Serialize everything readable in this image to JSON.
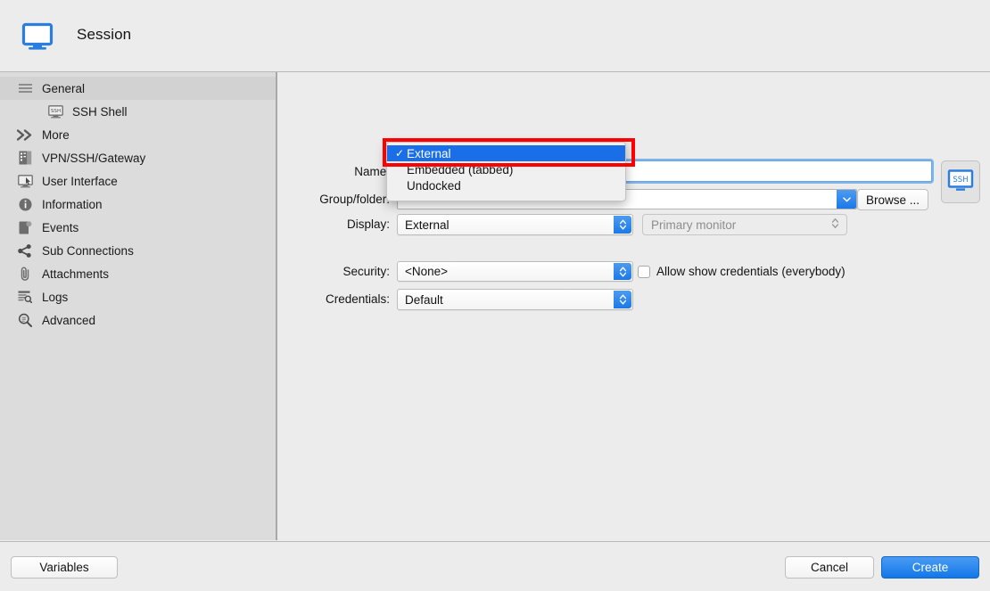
{
  "window": {
    "title": "Session",
    "icon": "monitor-icon"
  },
  "sidebar": {
    "items": [
      {
        "label": "General",
        "icon": "list-lines-icon",
        "selected": true,
        "sub": false
      },
      {
        "label": "SSH Shell",
        "icon": "ssh-terminal-icon",
        "selected": false,
        "sub": true
      },
      {
        "label": "More",
        "icon": "chevrons-right-icon",
        "selected": false,
        "sub": false
      },
      {
        "label": "VPN/SSH/Gateway",
        "icon": "server-icon",
        "selected": false,
        "sub": false
      },
      {
        "label": "User Interface",
        "icon": "monitor-cursor-icon",
        "selected": false,
        "sub": false
      },
      {
        "label": "Information",
        "icon": "info-circle-icon",
        "selected": false,
        "sub": false
      },
      {
        "label": "Events",
        "icon": "events-icon",
        "selected": false,
        "sub": false
      },
      {
        "label": "Sub Connections",
        "icon": "share-nodes-icon",
        "selected": false,
        "sub": false
      },
      {
        "label": "Attachments",
        "icon": "paperclip-icon",
        "selected": false,
        "sub": false
      },
      {
        "label": "Logs",
        "icon": "log-search-icon",
        "selected": false,
        "sub": false
      },
      {
        "label": "Advanced",
        "icon": "magnifier-icon",
        "selected": false,
        "sub": false
      }
    ]
  },
  "form": {
    "name": {
      "label": "Name:",
      "value": "",
      "placeholder": ""
    },
    "group": {
      "label": "Group/folder:",
      "value": "",
      "placeholder": ""
    },
    "display": {
      "label": "Display:",
      "value": "External",
      "options": [
        "External",
        "Embedded (tabbed)",
        "Undocked"
      ],
      "selected_index": 0
    },
    "monitor": {
      "value": "Primary monitor",
      "enabled": false
    },
    "security": {
      "label": "Security:",
      "value": "<None>"
    },
    "credentials": {
      "label": "Credentials:",
      "value": "Default"
    },
    "allow_show_credentials": {
      "label": "Allow show credentials (everybody)",
      "checked": false
    },
    "browse_button": "Browse ...",
    "ssh_button": "SSH"
  },
  "footer": {
    "variables": "Variables",
    "cancel": "Cancel",
    "create": "Create"
  },
  "colors": {
    "accent_blue": "#1a6ee8",
    "highlight_red": "#fe0000",
    "window_bg": "#ececec",
    "sidebar_bg": "#dcdcdc"
  }
}
